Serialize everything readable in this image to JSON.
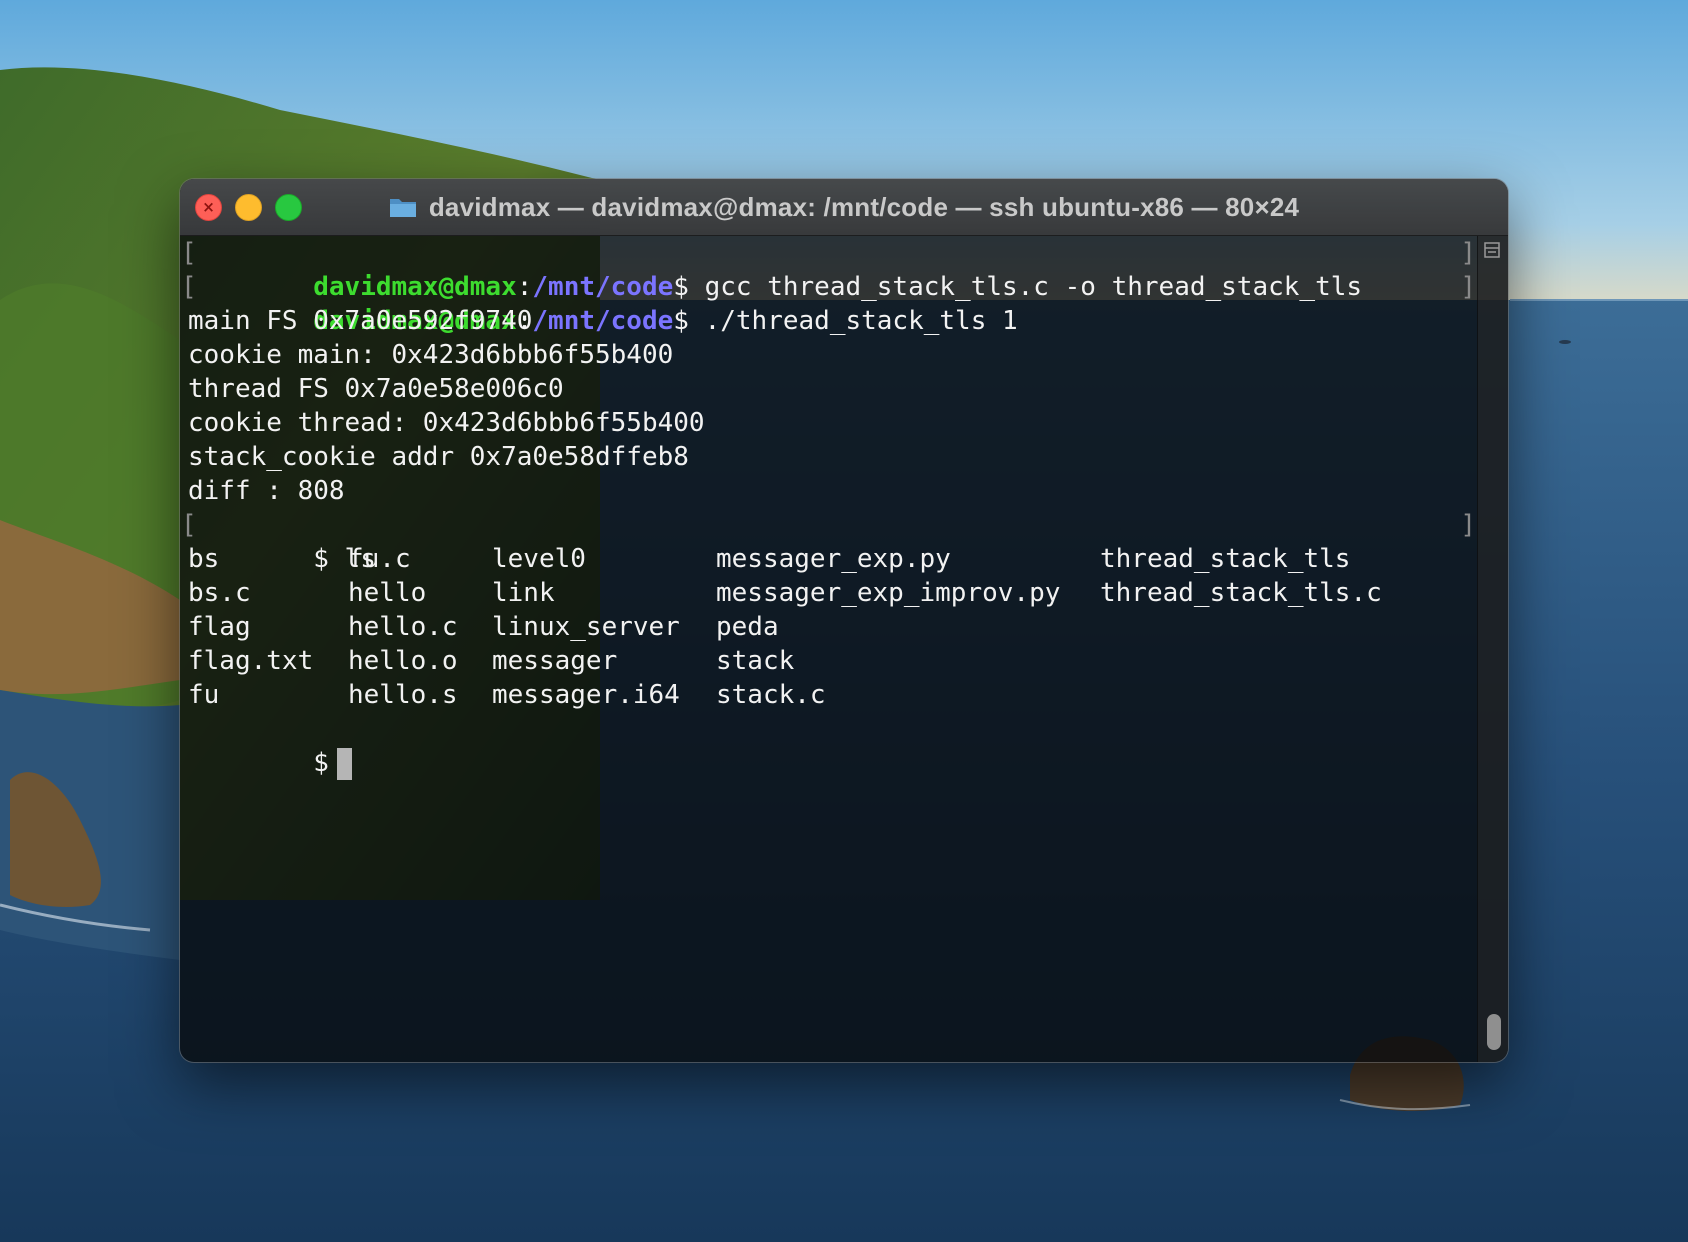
{
  "window": {
    "title": "davidmax — davidmax@dmax: /mnt/code — ssh ubuntu-x86 — 80×24",
    "controls": {
      "close": "close",
      "minimize": "minimize",
      "maximize": "maximize"
    }
  },
  "terminal": {
    "prompt1": {
      "user": "davidmax@dmax",
      "colon": ":",
      "path": "/mnt/code",
      "dollar": "$",
      "command": " gcc thread_stack_tls.c -o thread_stack_tls"
    },
    "prompt2": {
      "user": "davidmax@dmax",
      "colon": ":",
      "path": "/mnt/code",
      "dollar": "$",
      "command": " ./thread_stack_tls 1"
    },
    "output": [
      "main FS 0x7a0e592f9740",
      "cookie main: 0x423d6bbb6f55b400",
      "thread FS 0x7a0e58e006c0",
      "cookie thread: 0x423d6bbb6f55b400",
      "stack_cookie addr 0x7a0e58dffeb8",
      "diff : 808"
    ],
    "ls_command": "$ ls",
    "ls_rows": [
      [
        "bs",
        "fu.c",
        "level0",
        "messager_exp.py",
        "thread_stack_tls"
      ],
      [
        "bs.c",
        "hello",
        "link",
        "messager_exp_improv.py",
        "thread_stack_tls.c"
      ],
      [
        "flag",
        "hello.c",
        "linux_server",
        "peda",
        ""
      ],
      [
        "flag.txt",
        "hello.o",
        "messager",
        "stack",
        ""
      ],
      [
        "fu",
        "hello.s",
        "messager.i64",
        "stack.c",
        ""
      ]
    ],
    "final_prompt": "$",
    "mark_left": "[",
    "mark_right": "]"
  },
  "colors": {
    "user": "#3ddc2f",
    "path": "#7b74ff",
    "text": "#f2f2f2"
  }
}
